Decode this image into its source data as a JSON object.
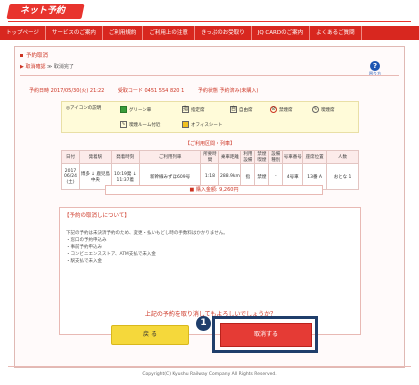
{
  "header": {
    "logo": "ネット予約"
  },
  "nav": {
    "items": [
      "トップページ",
      "サービスのご案内",
      "ご利用規約",
      "ご利用上の注意",
      "きっぷのお受取り",
      "JQ CARDのご案内",
      "よくあるご質問"
    ]
  },
  "page": {
    "title": "予約取消",
    "steps": [
      "取消確認",
      "取消完了"
    ],
    "help_label": "困り方",
    "info": [
      "予約日時 2017/05/30(火) 21:22",
      "受取コード 0451 554 820 1",
      "予約状態 予約済み(未購入)"
    ]
  },
  "legend": {
    "title": "アイコンの説明",
    "items": [
      "グリーン車",
      "指定席",
      "自由席",
      "禁煙席",
      "喫煙席",
      "喫煙ルーム付近",
      "オフィスシート"
    ],
    "icons": [
      "green-car-icon",
      "reserved-seat-icon",
      "non-reserved-icon",
      "no-smoking-icon",
      "smoking-icon",
      "smoking-room-icon",
      "office-seat-icon"
    ]
  },
  "itinerary": {
    "section_title": "【ご利用区間・列車】",
    "headers": [
      "日付",
      "発着駅",
      "発着時刻",
      "ご利用列車",
      "所要時間",
      "乗車距離",
      "利用設備",
      "禁煙喫煙",
      "設備種別",
      "号車番号",
      "座席位置",
      "人数"
    ],
    "row": [
      "2017 06/24 (土)",
      "博多 ↓ 鹿児島中央",
      "10:19発 ↓ 11:37着",
      "新幹線みずほ609号",
      "1:18",
      "288.9km",
      "指",
      "禁煙",
      "-",
      "4号車",
      "13番 A",
      "おとな 1"
    ],
    "total": "購入金額: 9,260円"
  },
  "cancel_info": {
    "title": "【予約の取消しについて】",
    "lines": [
      "下記の予約は未決済予約のため、変更・払いもどし時の手数料はかかりません。",
      "・窓口の予約申込み",
      "・事前予約申込み",
      "・コンビニエンスストア、ATM支払で未入金",
      "・駅支払で未入金"
    ]
  },
  "actions": {
    "confirm_question": "上記の予約を取り消してもよろしいでしょうか？",
    "back_label": "戻 る",
    "cancel_label": "取消する",
    "annotation_number": "1"
  },
  "footer": {
    "copyright": "Copyright(C) Kyushu Railway Company All Rights Reserved."
  },
  "colors": {
    "brand_red": "#d8271f",
    "highlight_navy": "#1f3e6b",
    "back_yellow": "#f5d83b"
  }
}
